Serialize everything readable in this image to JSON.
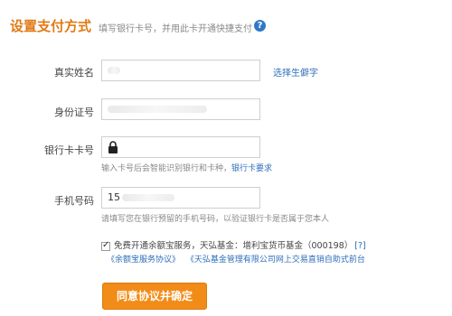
{
  "header": {
    "title": "设置支付方式",
    "subtitle": "填写银行卡号，并用此卡开通快捷支付",
    "help_icon": "?"
  },
  "form": {
    "name": {
      "label": "真实姓名",
      "value": "",
      "link": "选择生僻字"
    },
    "id": {
      "label": "身份证号",
      "value": ""
    },
    "card": {
      "label": "银行卡卡号",
      "value": "",
      "hint": "输入卡号后会智能识别银行和卡种，",
      "hint_link": "银行卡要求"
    },
    "phone": {
      "label": "手机号码",
      "value_prefix": "15",
      "hint": "请填写您在银行预留的手机号码，以验证银行卡是否属于您本人"
    }
  },
  "yuebao": {
    "checked": true,
    "text": "免费开通余额宝服务，天弘基金：增利宝货币基金（000198）",
    "help_link": "[?]",
    "agreement1": "《余额宝服务协议》",
    "agreement2": "《天弘基金管理有限公司网上交易直销自助式前台"
  },
  "submit_label": "同意协议并确定",
  "colors": {
    "accent": "#e07a14",
    "button": "#f28c18",
    "link": "#2f6fba"
  }
}
